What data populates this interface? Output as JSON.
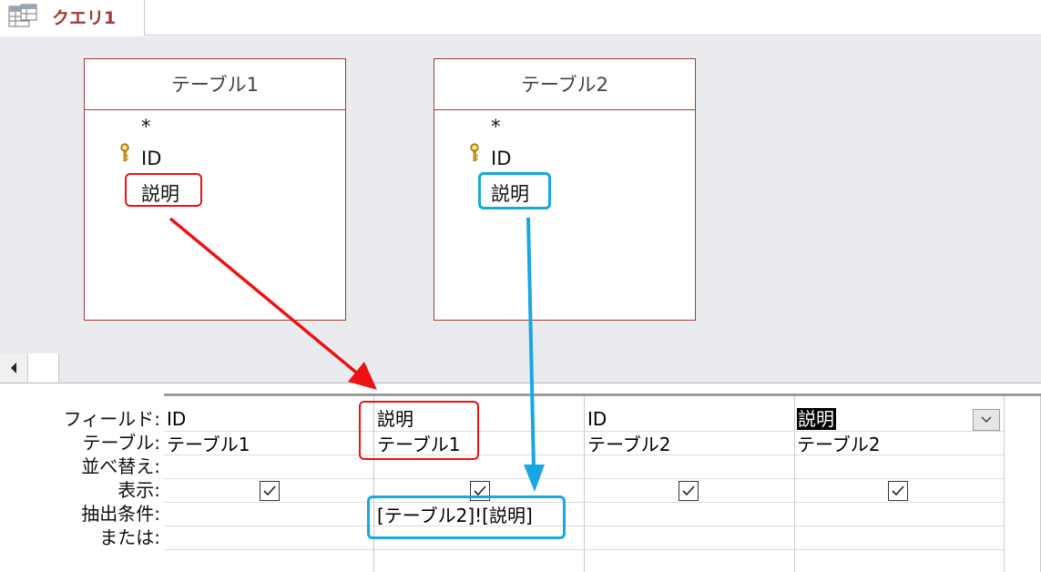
{
  "tab": {
    "label": "クエリ1",
    "icon": "query-datasheet-icon"
  },
  "tables": [
    {
      "title": "テーブル1",
      "fields": [
        "*",
        "ID",
        "説明"
      ],
      "primary_key": "ID"
    },
    {
      "title": "テーブル2",
      "fields": [
        "*",
        "ID",
        "説明"
      ],
      "primary_key": "ID"
    }
  ],
  "grid": {
    "row_labels": [
      "フィールド:",
      "テーブル:",
      "並べ替え:",
      "表示:",
      "抽出条件:",
      "または:"
    ],
    "columns": [
      {
        "field": "ID",
        "table": "テーブル1",
        "show": true,
        "criteria": ""
      },
      {
        "field": "説明",
        "table": "テーブル1",
        "show": true,
        "criteria": "[テーブル2]![説明]"
      },
      {
        "field": "ID",
        "table": "テーブル2",
        "show": true,
        "criteria": ""
      },
      {
        "field": "説明",
        "table": "テーブル2",
        "show": true,
        "criteria": "",
        "selected": true
      }
    ]
  },
  "colors": {
    "tab_text": "#a4373a",
    "table_border": "#a13939",
    "annotation_red": "#ee1111",
    "annotation_blue": "#19a7e4",
    "design_bg": "#e9ebef"
  }
}
